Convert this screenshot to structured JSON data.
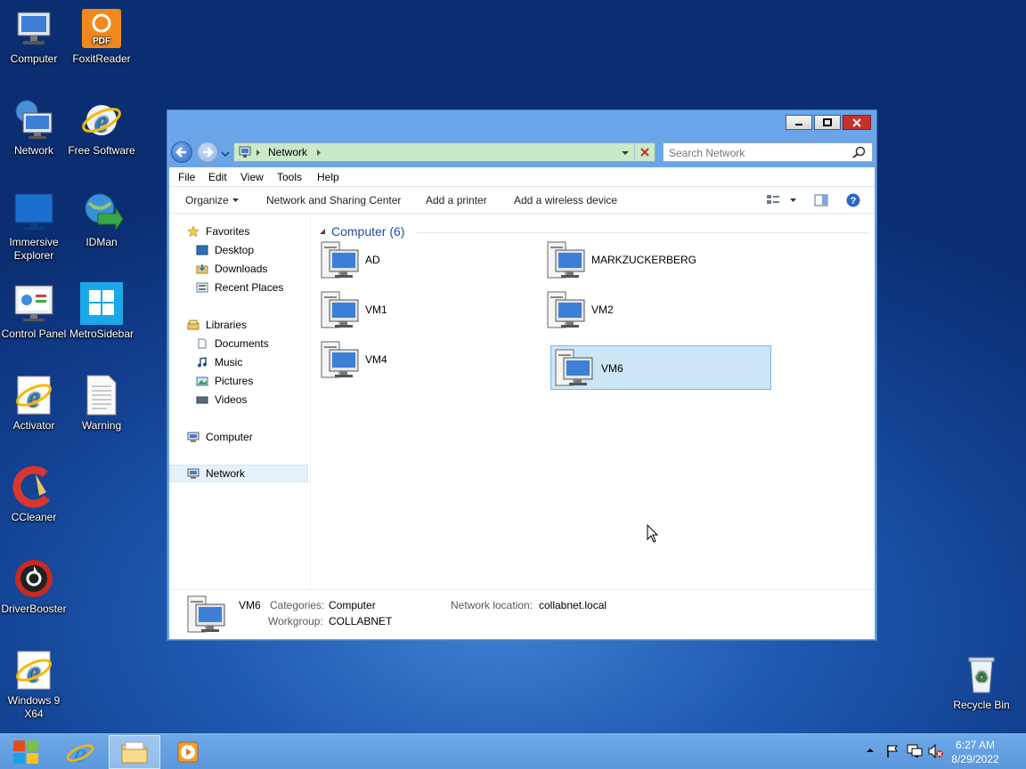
{
  "desktop": {
    "icons": [
      {
        "label": "Computer"
      },
      {
        "label": "FoxitReader"
      },
      {
        "label": "Network"
      },
      {
        "label": "Free Software"
      },
      {
        "label": "Immersive Explorer"
      },
      {
        "label": "IDMan"
      },
      {
        "label": "Control Panel"
      },
      {
        "label": "MetroSidebar"
      },
      {
        "label": "Activator"
      },
      {
        "label": "Warning"
      },
      {
        "label": "CCleaner"
      },
      {
        "label": "DriverBooster"
      },
      {
        "label": "Windows 9 X64"
      },
      {
        "label": "Recycle Bin"
      }
    ],
    "foxit_badge": "PDF"
  },
  "window": {
    "address": {
      "location": "Network"
    },
    "search": {
      "placeholder": "Search Network"
    },
    "menu": [
      "File",
      "Edit",
      "View",
      "Tools",
      "Help"
    ],
    "commands": {
      "organize": "Organize",
      "network_sharing": "Network and Sharing Center",
      "add_printer": "Add a printer",
      "add_wireless": "Add a wireless device"
    },
    "nav": {
      "favorites": "Favorites",
      "desktop": "Desktop",
      "downloads": "Downloads",
      "recent": "Recent Places",
      "libraries": "Libraries",
      "documents": "Documents",
      "music": "Music",
      "pictures": "Pictures",
      "videos": "Videos",
      "computer": "Computer",
      "network": "Network"
    },
    "group": {
      "title": "Computer (6)"
    },
    "computers": [
      {
        "name": "AD"
      },
      {
        "name": "MARKZUCKERBERG"
      },
      {
        "name": "VM1"
      },
      {
        "name": "VM2"
      },
      {
        "name": "VM4"
      },
      {
        "name": "VM6",
        "selected": true
      }
    ],
    "details": {
      "name": "VM6",
      "categories_label": "Categories:",
      "categories_value": "Computer",
      "workgroup_label": "Workgroup:",
      "workgroup_value": "COLLABNET",
      "location_label": "Network location:",
      "location_value": "collabnet.local"
    }
  },
  "taskbar": {
    "time": "6:27 AM",
    "date": "8/29/2022"
  },
  "colors": {
    "accent": "#6aa4e9",
    "selection": "#cde6f7",
    "close_button": "#c7312a"
  }
}
